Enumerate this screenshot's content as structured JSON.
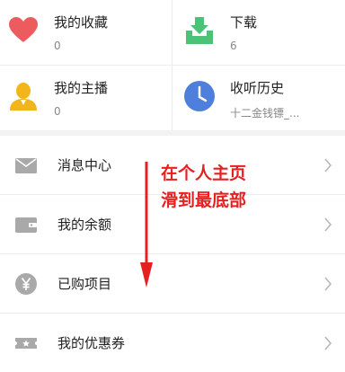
{
  "grid": {
    "favorites": {
      "title": "我的收藏",
      "count": "0"
    },
    "downloads": {
      "title": "下载",
      "count": "6"
    },
    "my_anchor": {
      "title": "我的主播",
      "count": "0"
    },
    "history": {
      "title": "收听历史",
      "subtitle": "十二金钱镖_..."
    }
  },
  "menu": [
    {
      "label": "消息中心",
      "icon": "message-icon"
    },
    {
      "label": "我的余额",
      "icon": "wallet-icon"
    },
    {
      "label": "已购项目",
      "icon": "yuan-coin-icon"
    },
    {
      "label": "我的优惠券",
      "icon": "coupon-icon"
    }
  ],
  "annotation": {
    "line1": "在个人主页",
    "line2": "滑到最底部"
  },
  "colors": {
    "heart": "#ec5c5f",
    "download": "#4cc276",
    "anchor": "#f2b51a",
    "history": "#4f7fdc",
    "menu_icon": "#a9a9a9",
    "annotation": "#e62020"
  }
}
